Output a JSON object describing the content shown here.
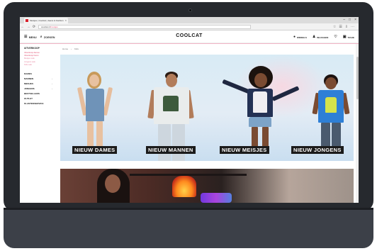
{
  "browser": {
    "tab_title": "Meisjes | Coolcat | Jeans & Fashion",
    "tab_close": "×",
    "url_host": "coolcat.nl",
    "url_ext": "/meisjes",
    "win_controls": [
      "–",
      "□",
      "×"
    ],
    "nav_icons": [
      "←",
      "→",
      "⟳"
    ],
    "addr_icons": [
      "☆",
      "☰",
      "⇩",
      "⋯"
    ]
  },
  "header": {
    "menu_label": "MENU",
    "search_label": "ZOEKEN",
    "logo": "COOLCAT",
    "winkels_label": "WINKELS",
    "account_label": "INLOGGEN",
    "wishlist_label": "",
    "cart_label": "TASJE"
  },
  "sidebar": {
    "title": "UITVERKOOP",
    "sub_items": [
      "Uitverkoop dames",
      "Uitverkoop heren",
      "Meisjes sale",
      "Jongens sale",
      "Kids sale"
    ],
    "main_items": [
      "DAMES",
      "MANNEN",
      "MEISJES",
      "JONGENS",
      "BESTSELLERS",
      "OUTLET",
      "KLANTENSERVICE"
    ]
  },
  "breadcrumb": [
    "Home",
    "›",
    "Kids"
  ],
  "hero": {
    "labels": [
      "NIEUW DAMES",
      "NIEUW MANNEN",
      "NIEUW MEISJES",
      "NIEUW JONGENS"
    ]
  },
  "colors": {
    "accent_pink": "#e04b6e",
    "label_bg": "#1b1b1b",
    "bezel": "#26292e"
  }
}
